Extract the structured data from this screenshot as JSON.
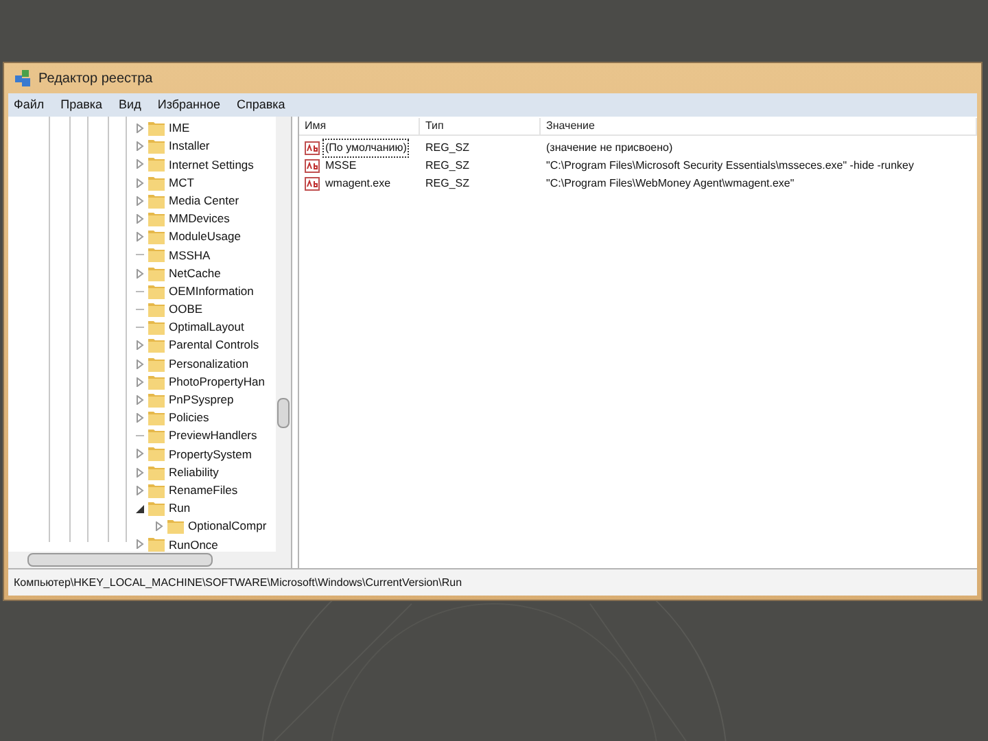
{
  "window": {
    "title": "Редактор реестра"
  },
  "menu": [
    "Файл",
    "Правка",
    "Вид",
    "Избранное",
    "Справка"
  ],
  "tree": [
    {
      "label": "IME",
      "kind": "collapsed"
    },
    {
      "label": "Installer",
      "kind": "collapsed"
    },
    {
      "label": "Internet Settings",
      "kind": "collapsed"
    },
    {
      "label": "MCT",
      "kind": "collapsed"
    },
    {
      "label": "Media Center",
      "kind": "collapsed"
    },
    {
      "label": "MMDevices",
      "kind": "collapsed"
    },
    {
      "label": "ModuleUsage",
      "kind": "collapsed"
    },
    {
      "label": "MSSHA",
      "kind": "leaf"
    },
    {
      "label": "NetCache",
      "kind": "collapsed"
    },
    {
      "label": "OEMInformation",
      "kind": "leaf"
    },
    {
      "label": "OOBE",
      "kind": "leaf"
    },
    {
      "label": "OptimalLayout",
      "kind": "leaf"
    },
    {
      "label": "Parental Controls",
      "kind": "collapsed"
    },
    {
      "label": "Personalization",
      "kind": "collapsed"
    },
    {
      "label": "PhotoPropertyHan",
      "kind": "collapsed"
    },
    {
      "label": "PnPSysprep",
      "kind": "collapsed"
    },
    {
      "label": "Policies",
      "kind": "collapsed"
    },
    {
      "label": "PreviewHandlers",
      "kind": "leaf"
    },
    {
      "label": "PropertySystem",
      "kind": "collapsed"
    },
    {
      "label": "Reliability",
      "kind": "collapsed"
    },
    {
      "label": "RenameFiles",
      "kind": "collapsed"
    },
    {
      "label": "Run",
      "kind": "expanded",
      "children": [
        {
          "label": "OptionalCompr",
          "kind": "collapsed"
        }
      ]
    },
    {
      "label": "RunOnce",
      "kind": "collapsed"
    }
  ],
  "table": {
    "columns": [
      "Имя",
      "Тип",
      "Значение"
    ],
    "rows": [
      {
        "cells": [
          "(По умолчанию)",
          "REG_SZ",
          "(значение не присвоено)"
        ],
        "selected": true
      },
      {
        "cells": [
          "MSSE",
          "REG_SZ",
          "\"C:\\Program Files\\Microsoft Security Essentials\\msseces.exe\" -hide -runkey"
        ],
        "selected": false
      },
      {
        "cells": [
          "wmagent.exe",
          "REG_SZ",
          "\"C:\\Program Files\\WebMoney Agent\\wmagent.exe\""
        ],
        "selected": false
      }
    ]
  },
  "status_bar": "Компьютер\\HKEY_LOCAL_MACHINE\\SOFTWARE\\Microsoft\\Windows\\CurrentVersion\\Run"
}
